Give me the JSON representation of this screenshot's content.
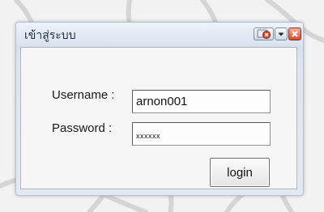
{
  "window": {
    "title": "เข้าสู่ระบบ",
    "controls": [
      "ie-close-icon",
      "dropdown-icon",
      "close-icon"
    ]
  },
  "form": {
    "username_label": "Username :",
    "username_value": "arnon001",
    "password_label": "Password :",
    "password_value": "xxxxxx",
    "login_label": "login"
  },
  "colors": {
    "close_button": "#d24a2c",
    "title_text": "#1f2d3d"
  }
}
